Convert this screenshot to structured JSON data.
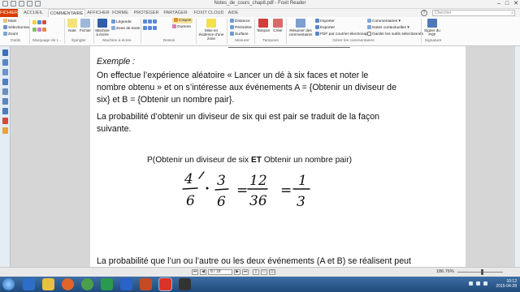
{
  "window": {
    "title": "Notes_de_cours_chap8.pdf - Foxit Reader",
    "controls": [
      "–",
      "□",
      "✕"
    ]
  },
  "tabs": [
    "FICHIER",
    "ACCUEIL",
    "COMMENTAIRE",
    "AFFICHER",
    "FORME",
    "PROTÉGER",
    "PARTAGER",
    "FOXIT CLOUD",
    "AIDE"
  ],
  "search_placeholder": "Chercher",
  "ribbon": {
    "outils": {
      "items": [
        "Main",
        "Sélectionner",
        "Zoom"
      ],
      "group": "Outils"
    },
    "marquage": {
      "group": "Marquage de t…"
    },
    "epingler": {
      "items": [
        "Note",
        "Fichier"
      ],
      "group": "Épingler"
    },
    "machine": {
      "items": [
        "Machine à écrire",
        "Légende",
        "Zone de texte"
      ],
      "group": "Machine à écrire"
    },
    "dessin": {
      "items": [
        "Crayon",
        "Gomme"
      ],
      "group": "Dessin"
    },
    "evidence": {
      "label": "Mise en évidence d'une zone"
    },
    "mesurer": {
      "items": [
        "Distance",
        "Périmètre",
        "Surface"
      ],
      "group": "Mesurer"
    },
    "tampons": {
      "items": [
        "Tampon",
        "Créer"
      ],
      "group": "Tampons"
    },
    "gerer": {
      "items": [
        "Résumer des commentaires",
        "Importer",
        "Exporter",
        "FDF par courrier électronique",
        "Commentaires",
        "Notes contextuelles",
        "Garder les outils sélectionnés"
      ],
      "group": "Gérer les commentaires"
    },
    "signature": {
      "label": "Signer du PDF",
      "group": "Signature"
    }
  },
  "document": {
    "example_label": "Exemple :",
    "para1": [
      "On effectue l’expérience aléatoire « Lancer un dé à six faces et noter le",
      "nombre obtenu » et on s’intéresse aux événements A = {Obtenir un diviseur de",
      "six} et B = {Obtenir un nombre pair}."
    ],
    "para2": [
      "La probabilité d’obtenir un diviseur de six qui est pair se traduit de la façon",
      "suivante."
    ],
    "formula_start": "P(Obtenir un diviseur de six ",
    "formula_et": "ET",
    "formula_end": " Obtenir un nombre pair)",
    "handwriting": [
      "4",
      "6",
      "3",
      "6",
      "=",
      "12",
      "36",
      "=",
      "1",
      "3"
    ],
    "para3": "La probabilité que l’un ou l’autre ou les deux événements (A et B) se réalisent peut"
  },
  "statusbar": {
    "page_display": "8 / 18",
    "zoom": "186.76%",
    "zoom_level": 0.55
  },
  "taskbar": {
    "time": "10:12",
    "date": "2015-04-28"
  },
  "colors": {
    "file_tab": "#d83b01",
    "taskbar": "#2b5a90",
    "sidebar": "#e4ecf4"
  }
}
